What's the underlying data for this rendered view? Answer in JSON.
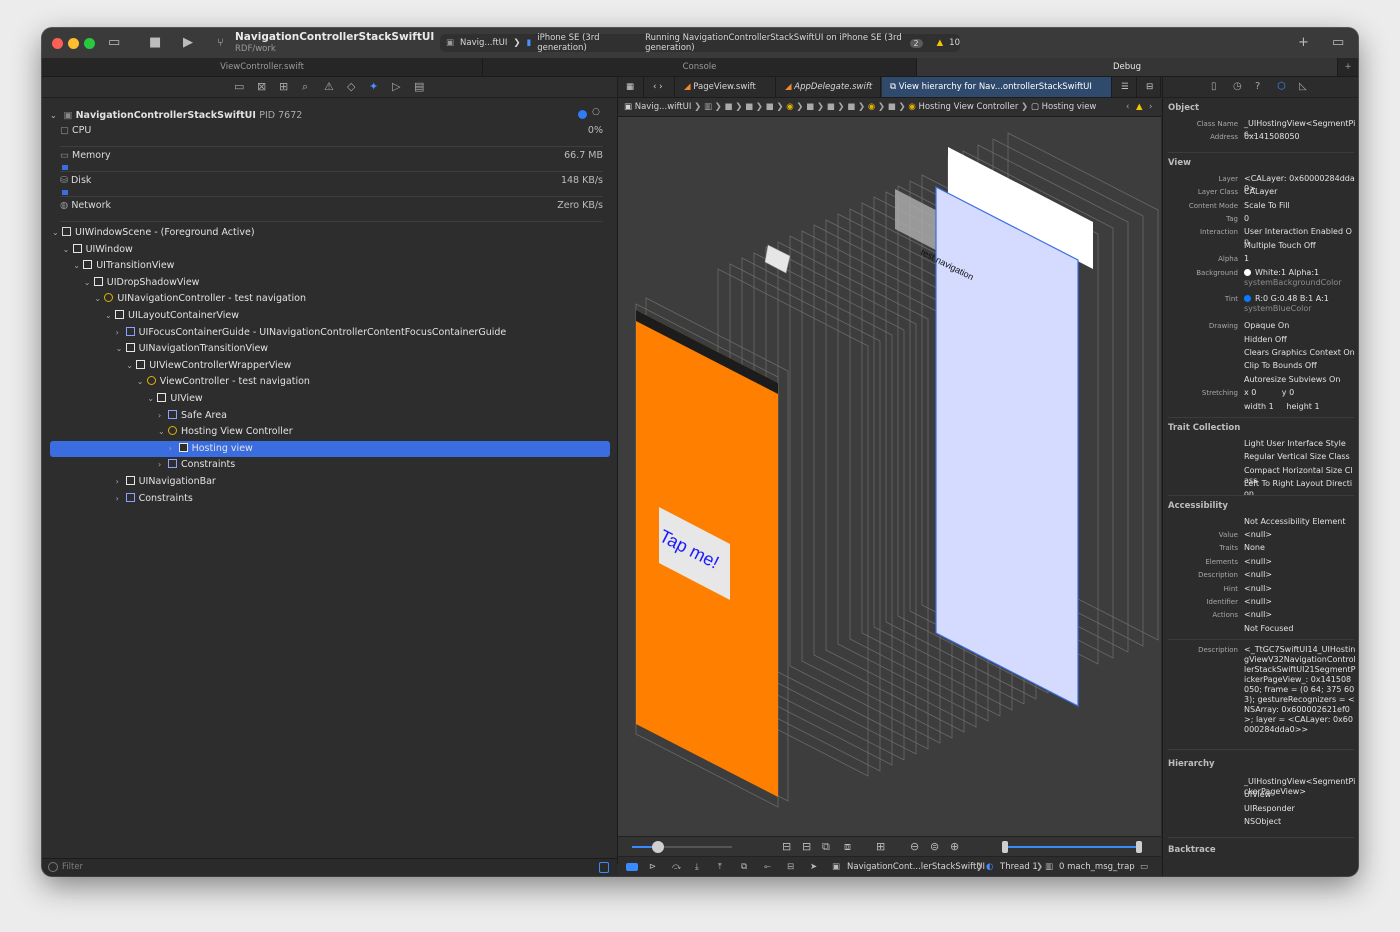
{
  "window": {
    "scheme_title": "NavigationControllerStackSwiftUI",
    "scheme_subtitle": "RDF/work",
    "activity": {
      "target": "Navig...ftUI",
      "device": "iPhone SE (3rd generation)",
      "status": "Running NavigationControllerStackSwiftUI on iPhone SE (3rd generation)",
      "count": "2",
      "warnings": "10"
    }
  },
  "tabs": {
    "left": "ViewController.swift",
    "middle": "Console",
    "right": "Debug"
  },
  "navigator": {
    "process": {
      "name": "NavigationControllerStackSwiftUI",
      "pid": "PID 7672"
    },
    "gauges": [
      {
        "label": "CPU",
        "value": "0%"
      },
      {
        "label": "Memory",
        "value": "66.7 MB"
      },
      {
        "label": "Disk",
        "value": "148 KB/s"
      },
      {
        "label": "Network",
        "value": "Zero KB/s"
      }
    ],
    "tree": [
      {
        "label": "UIWindowScene - (Foreground Active)",
        "depth": 0,
        "expanded": true,
        "icon": "scene-icon"
      },
      {
        "label": "UIWindow",
        "depth": 1,
        "expanded": true,
        "icon": "view-icon"
      },
      {
        "label": "UITransitionView",
        "depth": 2,
        "expanded": true,
        "icon": "view-icon"
      },
      {
        "label": "UIDropShadowView",
        "depth": 3,
        "expanded": true,
        "icon": "view-icon"
      },
      {
        "label": "UINavigationController - test navigation",
        "depth": 4,
        "expanded": true,
        "icon": "view-controller-icon"
      },
      {
        "label": "UILayoutContainerView",
        "depth": 5,
        "expanded": true,
        "icon": "view-icon"
      },
      {
        "label": "UIFocusContainerGuide - UINavigationControllerContentFocusContainerGuide",
        "depth": 6,
        "expanded": false,
        "icon": "layout-guide-icon"
      },
      {
        "label": "UINavigationTransitionView",
        "depth": 6,
        "expanded": true,
        "icon": "view-icon"
      },
      {
        "label": "UIViewControllerWrapperView",
        "depth": 7,
        "expanded": true,
        "icon": "view-icon"
      },
      {
        "label": "ViewController - test navigation",
        "depth": 8,
        "expanded": true,
        "icon": "view-controller-icon"
      },
      {
        "label": "UIView",
        "depth": 9,
        "expanded": true,
        "icon": "view-icon"
      },
      {
        "label": "Safe Area",
        "depth": 10,
        "expanded": false,
        "icon": "layout-guide-icon"
      },
      {
        "label": "Hosting View Controller",
        "depth": 10,
        "expanded": true,
        "icon": "view-controller-icon"
      },
      {
        "label": "Hosting view",
        "depth": 11,
        "expanded": false,
        "icon": "view-icon",
        "selected": true
      },
      {
        "label": "Constraints",
        "depth": 10,
        "expanded": false,
        "icon": "constraints-icon"
      },
      {
        "label": "UINavigationBar",
        "depth": 6,
        "expanded": false,
        "icon": "view-icon"
      },
      {
        "label": "Constraints",
        "depth": 6,
        "expanded": false,
        "icon": "constraints-icon"
      }
    ],
    "filter_placeholder": "Filter"
  },
  "editor": {
    "tabs": [
      "PageView.swift",
      "AppDelegate.swift",
      "View hierarchy for Nav...ontrollerStackSwiftUI"
    ],
    "jump_bar": {
      "first": "Navig...wiftUI",
      "hosting_vc": "Hosting View Controller",
      "hosting_view": "Hosting view"
    },
    "canvas": {
      "button_text": "Tap me!",
      "nav_title": "test navigation"
    },
    "debug_bar": {
      "scheme": "NavigationCont...lerStackSwiftUI",
      "thread": "Thread 1",
      "frame": "0 mach_msg_trap"
    }
  },
  "inspector": {
    "object": {
      "title": "Object",
      "fields": [
        {
          "k": "Class Name",
          "v": "_UIHostingView<SegmentPic..."
        },
        {
          "k": "Address",
          "v": "0x141508050"
        }
      ]
    },
    "view": {
      "title": "View",
      "fields": [
        {
          "k": "Layer",
          "v": "<CALayer: 0x60000284dda0>"
        },
        {
          "k": "Layer Class",
          "v": "CALayer"
        },
        {
          "k": "Content Mode",
          "v": "Scale To Fill"
        },
        {
          "k": "Tag",
          "v": "0"
        },
        {
          "k": "Interaction",
          "v": "User Interaction Enabled On"
        },
        {
          "k": "",
          "v": "Multiple Touch Off"
        },
        {
          "k": "Alpha",
          "v": "1"
        },
        {
          "k": "Background",
          "v": "White:1 Alpha:1",
          "sub": "systemBackgroundColor",
          "swatch": "#ffffff"
        },
        {
          "k": "Tint",
          "v": "R:0 G:0.48 B:1 A:1",
          "sub": "systemBlueColor",
          "swatch": "#0a7aff"
        },
        {
          "k": "Drawing",
          "v": "Opaque On"
        },
        {
          "k": "",
          "v": "Hidden Off"
        },
        {
          "k": "",
          "v": "Clears Graphics Context On"
        },
        {
          "k": "",
          "v": "Clip To Bounds Off"
        },
        {
          "k": "",
          "v": "Autoresize Subviews On"
        },
        {
          "k": "Stretching",
          "v": "x 0          y 0"
        },
        {
          "k": "",
          "v": "width 1     height 1"
        }
      ]
    },
    "trait": {
      "title": "Trait Collection",
      "items": [
        "Light User Interface Style",
        "Regular Vertical Size Class",
        "Compact Horizontal Size Class",
        "Left To Right Layout Direction"
      ]
    },
    "accessibility": {
      "title": "Accessibility",
      "fields": [
        {
          "k": "",
          "v": "Not Accessibility Element"
        },
        {
          "k": "Value",
          "v": "<null>"
        },
        {
          "k": "Traits",
          "v": "None"
        },
        {
          "k": "Elements",
          "v": "<null>"
        },
        {
          "k": "Description",
          "v": "<null>"
        },
        {
          "k": "Hint",
          "v": "<null>"
        },
        {
          "k": "Identifier",
          "v": "<null>"
        },
        {
          "k": "Actions",
          "v": "<null>"
        },
        {
          "k": "",
          "v": "Not Focused"
        }
      ]
    },
    "description": {
      "k": "Description",
      "v": "<_TtGC7SwiftUI14_UIHostingViewV32NavigationControllerStackSwiftUI21SegmentPickerPageView_: 0x141508050; frame = (0 64; 375 603); gestureRecognizers = <NSArray: 0x600002621ef0>; layer = <CALayer: 0x60000284dda0>>"
    },
    "hierarchy": {
      "title": "Hierarchy",
      "items": [
        "_UIHostingView<SegmentPickerPageView>",
        "UIView",
        "UIResponder",
        "NSObject"
      ]
    },
    "backtrace": {
      "title": "Backtrace"
    }
  },
  "colors": {
    "accent": "#3a6ee0",
    "orange_screen": "#ff8000",
    "selected_screen": "#d5dbff"
  }
}
